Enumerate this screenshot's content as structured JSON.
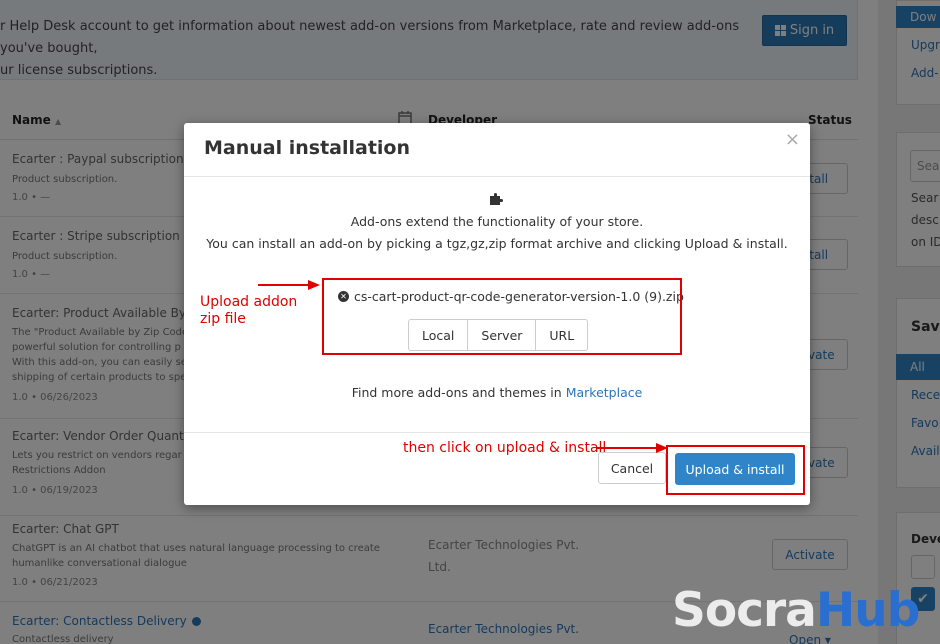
{
  "banner": {
    "text_line1": "r Help Desk account to get information about newest add-on versions from Marketplace, rate and review add-ons you've bought,",
    "text_line2": "ur license subscriptions.",
    "signin_label": "Sign in"
  },
  "table": {
    "headers": {
      "name": "Name",
      "developer": "Developer",
      "status": "Status"
    },
    "rows": [
      {
        "title": "Ecarter : Paypal subscription",
        "desc": "Product subscription.",
        "meta": "1.0 • —",
        "developer": "",
        "action": "Install"
      },
      {
        "title": "Ecarter : Stripe subscription",
        "desc": "Product subscription.",
        "meta": "1.0 • —",
        "developer": "",
        "action": "Install"
      },
      {
        "title": "Ecarter: Product Available By",
        "desc": "The \"Product Available by Zip Code\npowerful solution for controlling p\nWith this add-on, you can easily se\nshipping of certain products to spe",
        "meta": "1.0 • 06/26/2023",
        "developer": "",
        "action": "Activate"
      },
      {
        "title": "Ecarter: Vendor Order Quant",
        "desc": "Lets you restrict on vendors regar\nRestrictions Addon",
        "meta": "1.0 • 06/19/2023",
        "developer": "",
        "action": "Activate"
      },
      {
        "title": "Ecarter: Chat GPT",
        "desc": "ChatGPT is an AI chatbot that uses natural language processing to create\nhumanlike conversational dialogue",
        "meta": "1.0 • 06/21/2023",
        "developer": "Ecarter Technologies Pvt. Ltd.",
        "action": "Activate"
      },
      {
        "title": "Ecarter: Contactless Delivery",
        "desc": "Contactless delivery",
        "meta": "",
        "developer": "Ecarter Technologies Pvt.",
        "action": "Open ▾"
      }
    ]
  },
  "sidebar": {
    "top_items": [
      "Dow",
      "Upgr",
      "Add-"
    ],
    "search_placeholder": "Sea",
    "desc_lines": [
      "Sear",
      "desc",
      "on ID"
    ],
    "section_title": "Save",
    "filters": [
      "All",
      "Rece",
      "Favo",
      "Avail"
    ],
    "dev_title": "Deve"
  },
  "modal": {
    "title": "Manual installation",
    "close_label": "×",
    "intro_line1": "Add-ons extend the functionality of your store.",
    "intro_line2": "You can install an add-on by picking a tgz,gz,zip format archive and clicking Upload & install.",
    "file_name": "cs-cart-product-qr-code-generator-version-1.0 (9).zip",
    "source_tabs": [
      "Local",
      "Server",
      "URL"
    ],
    "find_more_prefix": "Find more add-ons and themes in ",
    "find_more_link": "Marketplace",
    "cancel_label": "Cancel",
    "upload_label": "Upload & install"
  },
  "annotations": {
    "upload_note": "Upload addon\nzip file",
    "click_note": "then click on upload & install",
    "color": "#e00000"
  },
  "watermark": {
    "part1": "Socra",
    "part2": "Hub"
  },
  "colors": {
    "accent": "#2f85c8",
    "link": "#2a75ba",
    "annotation": "#e00000"
  }
}
